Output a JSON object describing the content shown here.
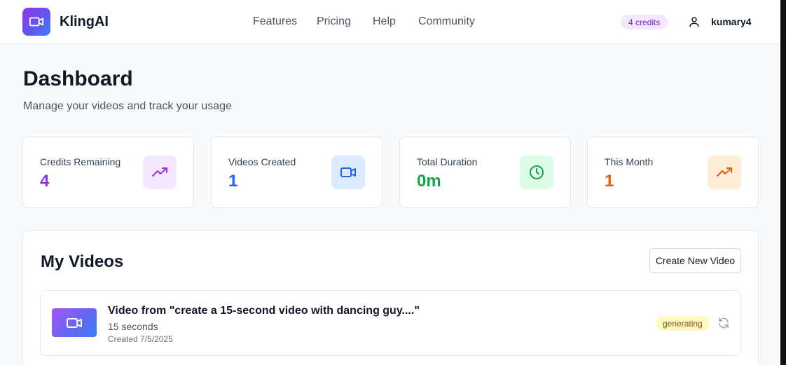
{
  "brand": {
    "name": "KlingAI",
    "logo_icon": "video-camera-icon"
  },
  "nav": {
    "features": "Features",
    "pricing": "Pricing",
    "help": "Help",
    "community": "Community"
  },
  "header": {
    "credits_badge": "4 credits",
    "username": "kumary4",
    "user_icon": "user-icon"
  },
  "page": {
    "title": "Dashboard",
    "subtitle": "Manage your videos and track your usage"
  },
  "stats": [
    {
      "label": "Credits Remaining",
      "value": "4",
      "icon": "trending-up-icon",
      "color": "#9333ea",
      "icon_bg": "#f3e8ff"
    },
    {
      "label": "Videos Created",
      "value": "1",
      "icon": "video-camera-icon",
      "color": "#2563eb",
      "icon_bg": "#dbeafe"
    },
    {
      "label": "Total Duration",
      "value": "0m",
      "icon": "clock-icon",
      "color": "#16a34a",
      "icon_bg": "#dcfce7"
    },
    {
      "label": "This Month",
      "value": "1",
      "icon": "trending-up-icon",
      "color": "#ea580c",
      "icon_bg": "#ffedd5"
    }
  ],
  "videos": {
    "title": "My Videos",
    "create_button": "Create New Video",
    "items": [
      {
        "title": "Video from \"create a 15-second video with dancing guy....\"",
        "duration": "15 seconds",
        "created": "Created 7/5/2025",
        "status": "generating"
      }
    ]
  },
  "colors": {
    "accent_purple": "#9333ea",
    "status_generating_bg": "#fef9c3",
    "status_generating_text": "#854d0e"
  }
}
